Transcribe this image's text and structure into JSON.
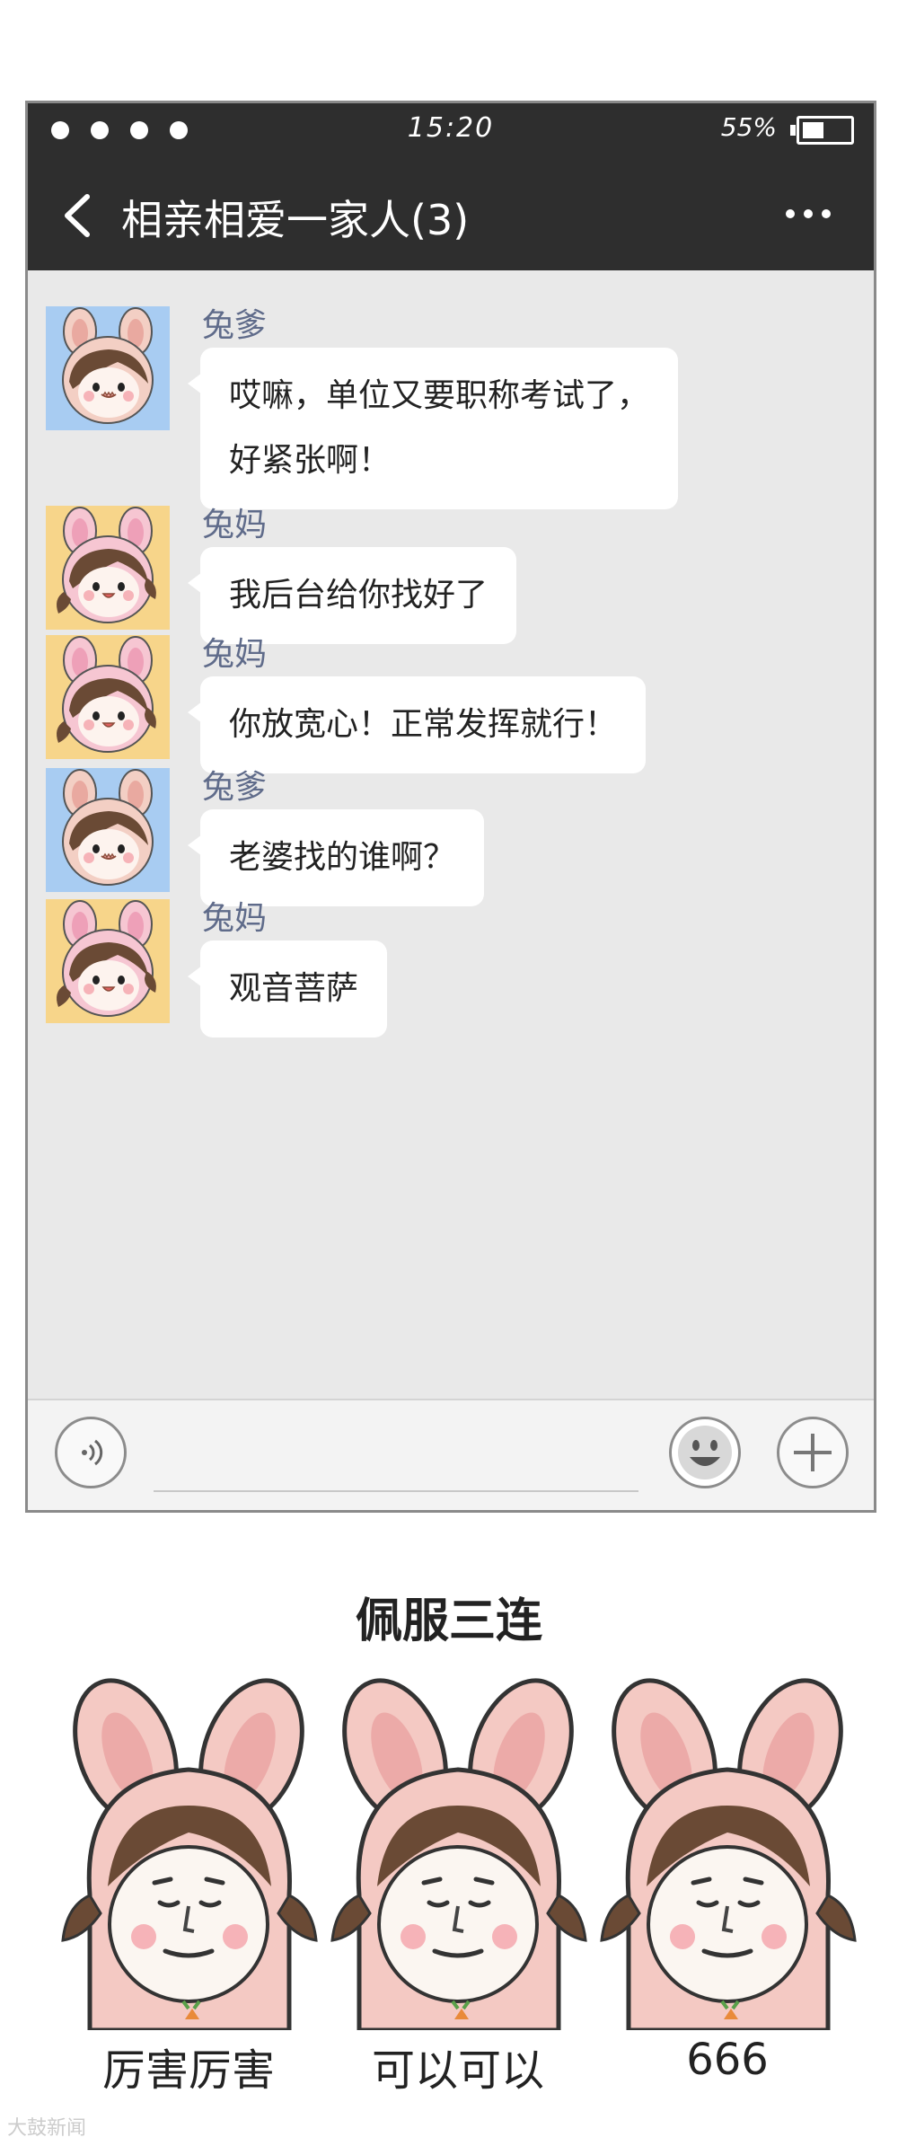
{
  "status_bar": {
    "time": "15:20",
    "battery": "55%"
  },
  "header": {
    "title": "相亲相爱一家人(3)"
  },
  "messages": [
    {
      "sender": "兔爹",
      "avatar": "rabbit-dad-avatar",
      "lines": [
        "哎嘛，单位又要职称考试了，",
        "好紧张啊！"
      ]
    },
    {
      "sender": "兔妈",
      "avatar": "rabbit-mom-avatar",
      "lines": [
        "我后台给你找好了"
      ]
    },
    {
      "sender": "兔妈",
      "avatar": "rabbit-mom-avatar",
      "lines": [
        "你放宽心！正常发挥就行！"
      ]
    },
    {
      "sender": "兔爹",
      "avatar": "rabbit-dad-avatar",
      "lines": [
        "老婆找的谁啊？"
      ]
    },
    {
      "sender": "兔妈",
      "avatar": "rabbit-mom-avatar",
      "lines": [
        "观音菩萨"
      ]
    }
  ],
  "sticker_section": {
    "title": "佩服三连",
    "stickers": [
      {
        "label": "厉害厉害"
      },
      {
        "label": "可以可以"
      },
      {
        "label": "666"
      }
    ]
  },
  "watermark": "大鼓新闻",
  "colors": {
    "header_bg": "#2e2e2e",
    "chat_bg": "#e9e9e9",
    "sender_name": "#5f6b8a",
    "dad_avatar_bg": "#a8ccf2",
    "mom_avatar_bg": "#f7d58a"
  }
}
